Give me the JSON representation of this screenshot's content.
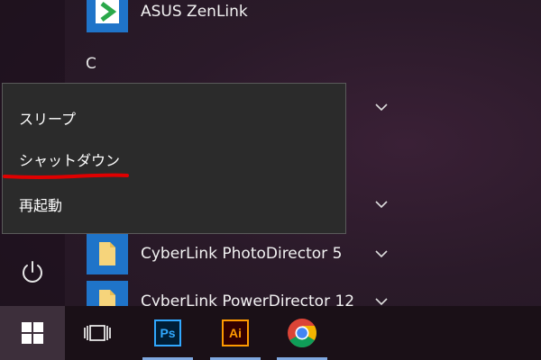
{
  "start_menu": {
    "apps": [
      {
        "label": "ASUS ZenLink",
        "icon": "zenlink-icon",
        "color": "#1f74c9"
      },
      {
        "label": "CyberLink PhotoDirector 5",
        "icon": "folder-icon",
        "color": "#1f74c9"
      },
      {
        "label": "CyberLink PowerDirector 12",
        "icon": "folder-icon",
        "color": "#1f74c9"
      }
    ],
    "section_letter": "C"
  },
  "power_menu": {
    "items": [
      {
        "label": "スリープ"
      },
      {
        "label": "シャットダウン",
        "highlighted": true
      },
      {
        "label": "再起動"
      }
    ],
    "highlight_color": "#e00000"
  },
  "taskbar": {
    "items": [
      {
        "name": "start",
        "icon": "windows-icon"
      },
      {
        "name": "task-view",
        "icon": "task-view-icon"
      },
      {
        "name": "photoshop",
        "icon": "photoshop-icon",
        "label": "Ps"
      },
      {
        "name": "illustrator",
        "icon": "illustrator-icon",
        "label": "Ai"
      },
      {
        "name": "chrome",
        "icon": "chrome-icon"
      }
    ]
  }
}
